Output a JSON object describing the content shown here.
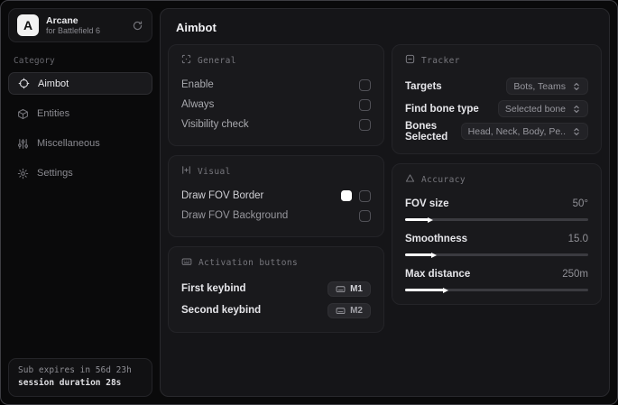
{
  "sidebar": {
    "logo_letter": "A",
    "app_name": "Arcane",
    "app_subtitle": "for Battlefield 6",
    "category_label": "Category",
    "items": [
      {
        "label": "Aimbot"
      },
      {
        "label": "Entities"
      },
      {
        "label": "Miscellaneous"
      },
      {
        "label": "Settings"
      }
    ],
    "footer": {
      "line1": "Sub expires in 56d 23h",
      "line2": "session duration 28s"
    }
  },
  "main": {
    "title": "Aimbot",
    "general": {
      "title": "General",
      "rows": [
        {
          "label": "Enable",
          "checked": false
        },
        {
          "label": "Always",
          "checked": false
        },
        {
          "label": "Visibility check",
          "checked": false
        }
      ]
    },
    "visual": {
      "title": "Visual",
      "rows": [
        {
          "label": "Draw FOV Border",
          "swatch": "#ffffff",
          "checked": false
        },
        {
          "label": "Draw FOV Background",
          "checked": false
        }
      ]
    },
    "activation": {
      "title": "Activation buttons",
      "rows": [
        {
          "label": "First keybind",
          "key": "M1"
        },
        {
          "label": "Second keybind",
          "key": "M2"
        }
      ]
    },
    "tracker": {
      "title": "Tracker",
      "rows": [
        {
          "label": "Targets",
          "value": "Bots, Teams"
        },
        {
          "label": "Find bone type",
          "value": "Selected bone"
        },
        {
          "label": "Bones Selected",
          "value": "Head, Neck, Body, Pe.."
        }
      ]
    },
    "accuracy": {
      "title": "Accuracy",
      "rows": [
        {
          "label": "FOV size",
          "value": "50°",
          "fill_pct": 13
        },
        {
          "label": "Smoothness",
          "value": "15.0",
          "fill_pct": 15
        },
        {
          "label": "Max distance",
          "value": "250m",
          "fill_pct": 21
        }
      ]
    }
  },
  "colors": {
    "fov_border_swatch": "#ffffff"
  }
}
